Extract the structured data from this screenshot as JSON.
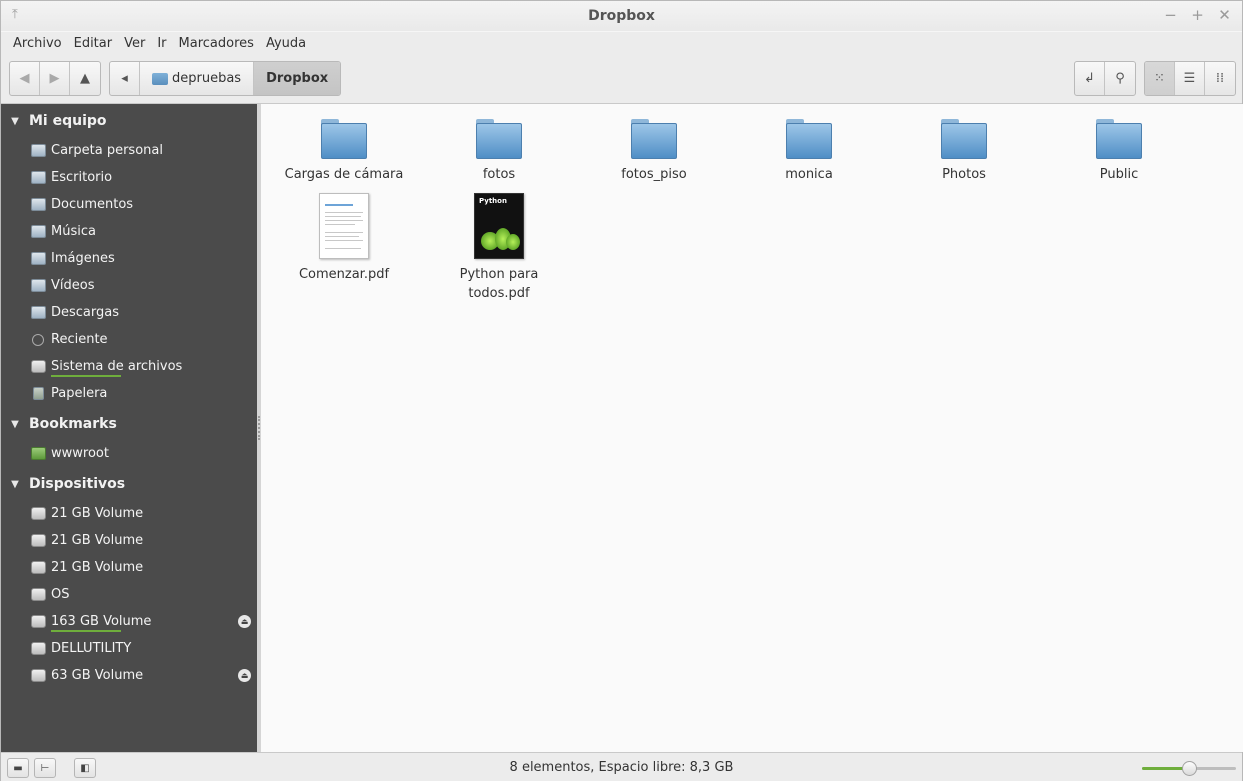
{
  "window": {
    "title": "Dropbox"
  },
  "menu": [
    "Archivo",
    "Editar",
    "Ver",
    "Ir",
    "Marcadores",
    "Ayuda"
  ],
  "breadcrumb": {
    "parent": "depruebas",
    "current": "Dropbox"
  },
  "sidebar": {
    "sections": [
      {
        "title": "Mi equipo",
        "items": [
          {
            "label": "Carpeta personal",
            "icon": "home-folder-icon"
          },
          {
            "label": "Escritorio",
            "icon": "desktop-icon"
          },
          {
            "label": "Documentos",
            "icon": "documents-folder-icon"
          },
          {
            "label": "Música",
            "icon": "music-folder-icon"
          },
          {
            "label": "Imágenes",
            "icon": "pictures-folder-icon"
          },
          {
            "label": "Vídeos",
            "icon": "videos-folder-icon"
          },
          {
            "label": "Descargas",
            "icon": "downloads-folder-icon"
          },
          {
            "label": "Reciente",
            "icon": "recent-icon"
          },
          {
            "label": "Sistema de archivos",
            "icon": "drive-icon"
          },
          {
            "label": "Papelera",
            "icon": "trash-icon"
          }
        ]
      },
      {
        "title": "Bookmarks",
        "items": [
          {
            "label": "wwwroot",
            "icon": "bookmark-folder-icon"
          }
        ]
      },
      {
        "title": "Dispositivos",
        "items": [
          {
            "label": "21 GB Volume",
            "icon": "drive-icon"
          },
          {
            "label": "21 GB Volume",
            "icon": "drive-icon"
          },
          {
            "label": "21 GB Volume",
            "icon": "drive-icon"
          },
          {
            "label": "OS",
            "icon": "drive-icon"
          },
          {
            "label": "163 GB Volume",
            "icon": "drive-icon",
            "eject": true
          },
          {
            "label": "DELLUTILITY",
            "icon": "drive-icon"
          },
          {
            "label": "63 GB Volume",
            "icon": "drive-icon",
            "eject": true
          }
        ]
      }
    ]
  },
  "files": [
    {
      "name": "Cargas de cámara",
      "type": "folder"
    },
    {
      "name": "fotos",
      "type": "folder"
    },
    {
      "name": "fotos_piso",
      "type": "folder"
    },
    {
      "name": "monica",
      "type": "folder"
    },
    {
      "name": "Photos",
      "type": "folder"
    },
    {
      "name": "Public",
      "type": "folder"
    },
    {
      "name": "Comenzar.pdf",
      "type": "pdf"
    },
    {
      "name": "Python para todos.pdf",
      "type": "pdf",
      "thumb_title": "Python"
    }
  ],
  "status": {
    "text": "8 elementos, Espacio libre: 8,3 GB"
  },
  "zoom": {
    "level": 0.5
  },
  "colors": {
    "sidebar_bg": "#4b4b4b",
    "accent": "#6fae3c",
    "folder": "#5a97cc"
  }
}
